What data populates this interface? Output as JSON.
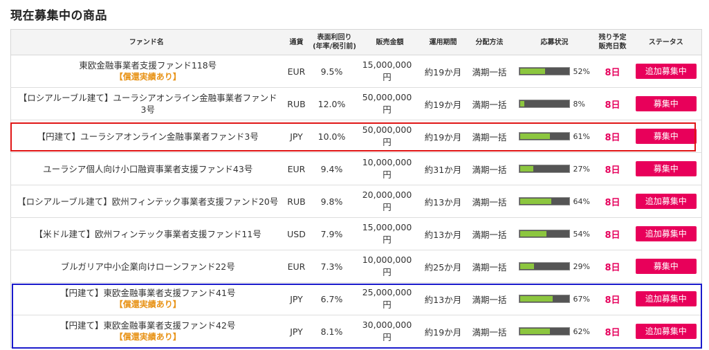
{
  "page": {
    "title": "現在募集中の商品"
  },
  "headers": {
    "name": "ファンド名",
    "currency": "通貨",
    "yield_line1": "表面利回り",
    "yield_line2": "(年率/税引前)",
    "amount": "販売金額",
    "period": "運用期間",
    "distribution": "分配方法",
    "application": "応募状況",
    "days_line1": "残り予定",
    "days_line2": "販売日数",
    "status": "ステータス"
  },
  "colors": {
    "accent": "#e8005a",
    "progress": "#8cc63f",
    "badge": "#e8941a",
    "highlight_red": "#e01414",
    "highlight_blue": "#1a1acc"
  },
  "funds": [
    {
      "name": "東欧金融事業者支援ファンド118号",
      "badge": "【償還実績あり】",
      "currency": "EUR",
      "yield": "9.5%",
      "amount": "15,000,000円",
      "period": "約19か月",
      "distribution": "満期一括",
      "progress": 52,
      "progress_label": "52%",
      "days": "8日",
      "status": "追加募集中"
    },
    {
      "name": "【ロシアルーブル建て】ユーラシアオンライン金融事業者ファンド3号",
      "badge": "",
      "currency": "RUB",
      "yield": "12.0%",
      "amount": "50,000,000円",
      "period": "約19か月",
      "distribution": "満期一括",
      "progress": 8,
      "progress_label": "8%",
      "days": "8日",
      "status": "募集中"
    },
    {
      "name": "【円建て】ユーラシアオンライン金融事業者ファンド3号",
      "badge": "",
      "currency": "JPY",
      "yield": "10.0%",
      "amount": "50,000,000円",
      "period": "約19か月",
      "distribution": "満期一括",
      "progress": 61,
      "progress_label": "61%",
      "days": "8日",
      "status": "募集中"
    },
    {
      "name": "ユーラシア個人向け小口融資事業者支援ファンド43号",
      "badge": "",
      "currency": "EUR",
      "yield": "9.4%",
      "amount": "10,000,000円",
      "period": "約31か月",
      "distribution": "満期一括",
      "progress": 27,
      "progress_label": "27%",
      "days": "8日",
      "status": "募集中"
    },
    {
      "name": "【ロシアルーブル建て】欧州フィンテック事業者支援ファンド20号",
      "badge": "",
      "currency": "RUB",
      "yield": "9.8%",
      "amount": "20,000,000円",
      "period": "約13か月",
      "distribution": "満期一括",
      "progress": 64,
      "progress_label": "64%",
      "days": "8日",
      "status": "追加募集中"
    },
    {
      "name": "【米ドル建て】欧州フィンテック事業者支援ファンド11号",
      "badge": "",
      "currency": "USD",
      "yield": "7.9%",
      "amount": "15,000,000円",
      "period": "約13か月",
      "distribution": "満期一括",
      "progress": 54,
      "progress_label": "54%",
      "days": "8日",
      "status": "追加募集中"
    },
    {
      "name": "ブルガリア中小企業向けローンファンド22号",
      "badge": "",
      "currency": "EUR",
      "yield": "7.3%",
      "amount": "10,000,000円",
      "period": "約25か月",
      "distribution": "満期一括",
      "progress": 29,
      "progress_label": "29%",
      "days": "8日",
      "status": "募集中"
    },
    {
      "name": "【円建て】東欧金融事業者支援ファンド41号",
      "badge": "【償還実績あり】",
      "currency": "JPY",
      "yield": "6.7%",
      "amount": "25,000,000円",
      "period": "約13か月",
      "distribution": "満期一括",
      "progress": 67,
      "progress_label": "67%",
      "days": "8日",
      "status": "追加募集中"
    },
    {
      "name": "【円建て】東欧金融事業者支援ファンド42号",
      "badge": "【償還実績あり】",
      "currency": "JPY",
      "yield": "8.1%",
      "amount": "30,000,000円",
      "period": "約19か月",
      "distribution": "満期一括",
      "progress": 62,
      "progress_label": "62%",
      "days": "8日",
      "status": "追加募集中"
    }
  ]
}
